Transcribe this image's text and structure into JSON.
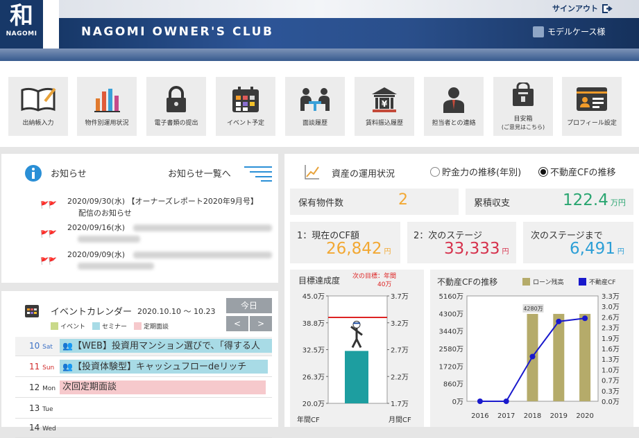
{
  "header": {
    "logo_kanji": "和",
    "logo_text": "NAGOMI",
    "title": "NAGOMI OWNER'S CLUB",
    "sign_out": "サインアウト",
    "user": "モデルケース様"
  },
  "menu": [
    {
      "label": "出納帳入力",
      "icon": "book-pen-icon"
    },
    {
      "label": "物件別運用状況",
      "icon": "bar-chart-icon"
    },
    {
      "label": "電子書類の提出",
      "icon": "lock-icon"
    },
    {
      "label": "イベント予定",
      "icon": "calendar-icon"
    },
    {
      "label": "面談履歴",
      "icon": "meeting-icon"
    },
    {
      "label": "賃料振込履歴",
      "icon": "bank-yen-icon"
    },
    {
      "label": "担当者との連絡",
      "icon": "person-icon"
    },
    {
      "label": "目安箱",
      "sub": "(ご意見はこちら)",
      "icon": "suggestion-box-icon"
    },
    {
      "label": "プロフィール設定",
      "icon": "id-card-icon"
    }
  ],
  "news": {
    "title": "お知らせ",
    "list_link": "お知らせ一覧へ",
    "items": [
      {
        "date": "2020/09/30(水)",
        "text": "【オーナーズレポート2020年9月号】",
        "text2": "配信のお知らせ"
      },
      {
        "date": "2020/09/16(水)",
        "text": ""
      },
      {
        "date": "2020/09/09(水)",
        "text": ""
      }
    ]
  },
  "calendar": {
    "title": "イベントカレンダー",
    "range": "2020.10.10 ～ 10.23",
    "today_btn": "今日",
    "prev": "<",
    "next": ">",
    "legend": [
      {
        "label": "イベント",
        "color": "#c9d98a"
      },
      {
        "label": "セミナー",
        "color": "#a8dbe6"
      },
      {
        "label": "定期面談",
        "color": "#f6c9cc"
      }
    ],
    "rows": [
      {
        "day": "10",
        "dow": "Sat",
        "event": "【WEB】投資用マンション選びで、「得する人",
        "type": "seminar",
        "color": "#3a6fc4"
      },
      {
        "day": "11",
        "dow": "Sun",
        "event": "【投資体験型】キャッシュフローdeリッチ",
        "type": "seminar",
        "color": "#d02a2a"
      },
      {
        "day": "12",
        "dow": "Mon",
        "event": "次回定期面談",
        "type": "meeting",
        "color": "#333"
      },
      {
        "day": "13",
        "dow": "Tue",
        "event": "",
        "type": "",
        "color": "#333"
      },
      {
        "day": "14",
        "dow": "Wed",
        "event": "",
        "type": "",
        "color": "#333"
      }
    ]
  },
  "assets": {
    "title": "資産の運用状況",
    "radio1": "貯金力の推移(年別)",
    "radio2": "不動産CFの推移",
    "owned_label": "保有物件数",
    "owned_value": "2",
    "cumulative_label": "累積収支",
    "cumulative_value": "122.4",
    "cumulative_unit": "万円",
    "cf_label": "1：現在のCF額",
    "cf_value": "26,842",
    "cf_unit": "円",
    "next_label": "2：次のステージ",
    "next_value": "33,333",
    "next_unit": "円",
    "remain_label": "次のステージまで",
    "remain_value": "6,491",
    "remain_unit": "円"
  },
  "chart_data": [
    {
      "type": "bar",
      "title": "目標達成度",
      "annotation": "次の目標：年間40万",
      "ylabel": "年間CF",
      "y2label": "月間CF",
      "yticks": [
        "45.0万",
        "38.8万",
        "32.5万",
        "26.3万",
        "20.0万"
      ],
      "y2ticks": [
        "3.7万",
        "3.2万",
        "2.7万",
        "2.2万",
        "1.7万"
      ],
      "ylim": [
        20,
        45
      ],
      "value": 32.2,
      "target": 40
    },
    {
      "type": "bar+line",
      "title": "不動産CFの推移",
      "categories": [
        "2016",
        "2017",
        "2018",
        "2019",
        "2020"
      ],
      "series": [
        {
          "name": "ローン残高",
          "values": [
            0,
            0,
            4280,
            4280,
            4280
          ],
          "color": "#b5ab6a"
        },
        {
          "name": "不動産CF",
          "values": [
            0,
            0,
            1.4,
            2.5,
            2.6
          ],
          "color": "#1919cc"
        }
      ],
      "bar_label": "4280万",
      "yticks": [
        "5160万",
        "4300万",
        "3440万",
        "2580万",
        "1720万",
        "860万",
        "0万"
      ],
      "y2ticks": [
        "3.3万",
        "3.0万",
        "2.6万",
        "2.3万",
        "1.9万",
        "1.6万",
        "1.3万",
        "1.0万",
        "0.7万",
        "0.3万",
        "0.0万"
      ],
      "ylim": [
        0,
        5160
      ],
      "y2lim": [
        0,
        3.3
      ]
    }
  ]
}
